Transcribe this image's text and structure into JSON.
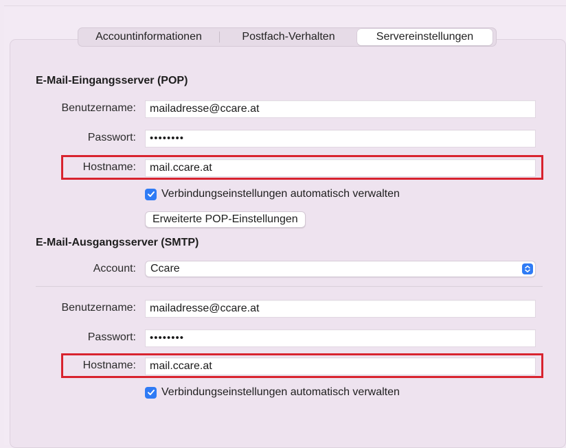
{
  "tabs": [
    {
      "label": "Accountinformationen",
      "active": false
    },
    {
      "label": "Postfach-Verhalten",
      "active": false
    },
    {
      "label": "Servereinstellungen",
      "active": true
    }
  ],
  "incoming": {
    "title": "E-Mail-Eingangsserver (POP)",
    "username_label": "Benutzername:",
    "username_value": "mailadresse@ccare.at",
    "password_label": "Passwort:",
    "password_value": "••••••••",
    "hostname_label": "Hostname:",
    "hostname_value": "mail.ccare.at",
    "auto_manage_label": "Verbindungseinstellungen automatisch verwalten",
    "auto_manage_checked": true,
    "advanced_button": "Erweiterte POP-Einstellungen"
  },
  "outgoing": {
    "title": "E-Mail-Ausgangsserver (SMTP)",
    "account_label": "Account:",
    "account_value": "Ccare",
    "username_label": "Benutzername:",
    "username_value": "mailadresse@ccare.at",
    "password_label": "Passwort:",
    "password_value": "••••••••",
    "hostname_label": "Hostname:",
    "hostname_value": "mail.ccare.at",
    "auto_manage_label": "Verbindungseinstellungen automatisch verwalten",
    "auto_manage_checked": true
  },
  "icons": {
    "checkbox": "checkmark-icon",
    "select": "up-down-chevron-icon"
  },
  "colors": {
    "accent": "#2f7bf5",
    "highlight_box": "#d8232e",
    "background": "#f2e9f3"
  }
}
